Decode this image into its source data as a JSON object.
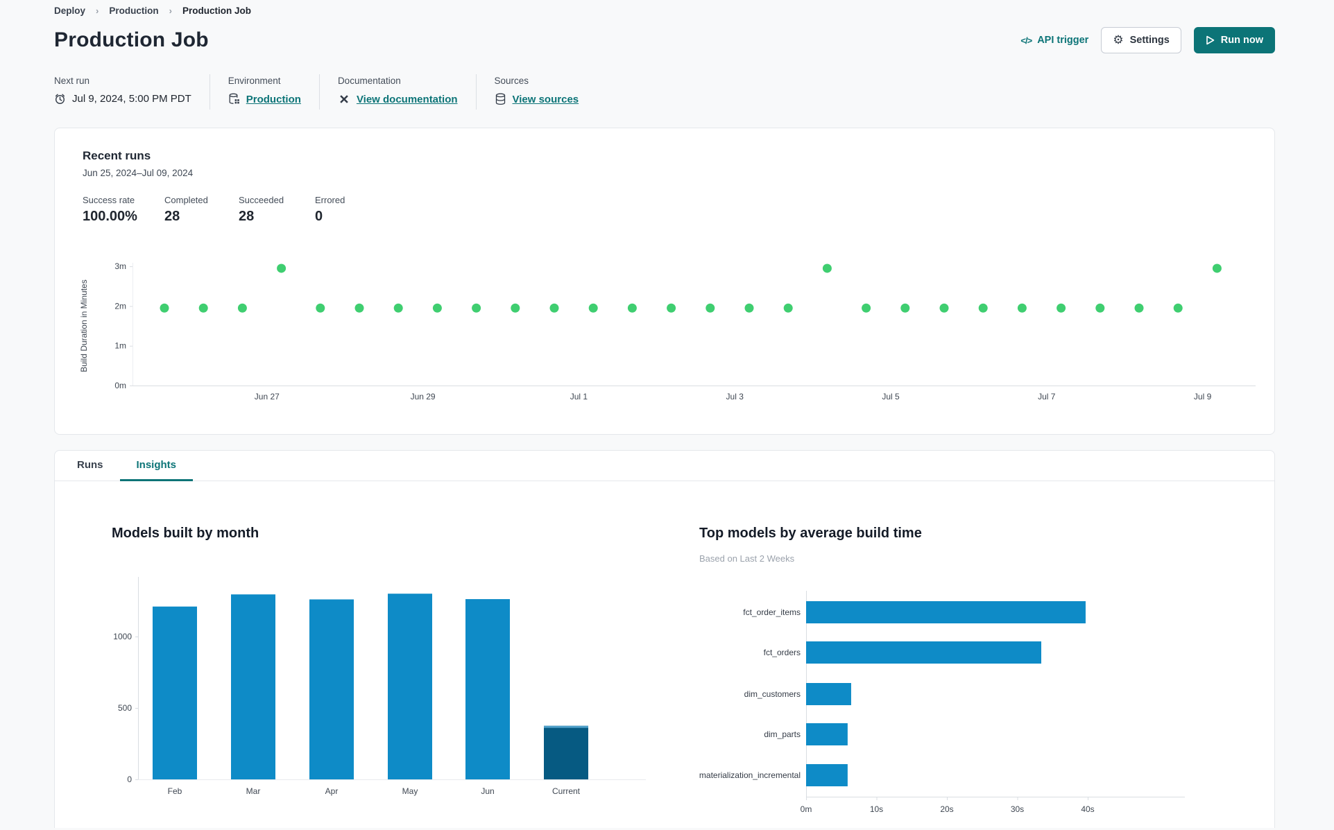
{
  "breadcrumb": {
    "items": [
      "Deploy",
      "Production",
      "Production Job"
    ]
  },
  "header": {
    "title": "Production Job",
    "api_trigger_label": "API trigger",
    "api_trigger_icon": "</>",
    "settings_label": "Settings",
    "settings_icon": "⚙",
    "run_now_label": "Run now"
  },
  "info": {
    "next_run": {
      "label": "Next run",
      "value": "Jul 9, 2024, 5:00 PM PDT",
      "icon": "alarm-clock"
    },
    "environment": {
      "label": "Environment",
      "value": "Production",
      "icon": "environment-database"
    },
    "documentation": {
      "label": "Documentation",
      "value": "View documentation",
      "icon": "dbt-logo"
    },
    "sources": {
      "label": "Sources",
      "value": "View sources",
      "icon": "database"
    }
  },
  "recent_runs": {
    "title": "Recent runs",
    "date_range": "Jun 25, 2024–Jul 09, 2024",
    "stats": [
      {
        "label": "Success rate",
        "value": "100.00%"
      },
      {
        "label": "Completed",
        "value": "28"
      },
      {
        "label": "Succeeded",
        "value": "28"
      },
      {
        "label": "Errored",
        "value": "0"
      }
    ]
  },
  "tabs": [
    {
      "label": "Runs",
      "active": false
    },
    {
      "label": "Insights",
      "active": true
    }
  ],
  "chart_data": [
    {
      "id": "build-duration-scatter",
      "type": "scatter",
      "ylabel": "Build Duration in Minutes",
      "yticks": [
        "0m",
        "1m",
        "2m",
        "3m"
      ],
      "ylim": [
        0,
        3.3
      ],
      "xticks": [
        "Jun 27",
        "Jun 29",
        "Jul 1",
        "Jul 3",
        "Jul 5",
        "Jul 7",
        "Jul 9"
      ],
      "x_range_dates": [
        "Jun 25, 2024",
        "Jul 09, 2024"
      ],
      "points_minutes": [
        1.95,
        1.95,
        1.95,
        2.95,
        1.95,
        1.95,
        1.95,
        1.95,
        1.95,
        1.95,
        1.95,
        1.95,
        1.95,
        1.95,
        1.95,
        1.95,
        1.95,
        2.95,
        1.95,
        1.95,
        1.95,
        1.95,
        1.95,
        1.95,
        1.95,
        1.95,
        1.95,
        2.95
      ],
      "point_color": "#3fce70",
      "grid": false
    },
    {
      "id": "models-built-by-month",
      "type": "bar",
      "title": "Models built by month",
      "categories": [
        "Feb",
        "Mar",
        "Apr",
        "May",
        "Jun",
        "Current"
      ],
      "values": [
        1210,
        1295,
        1260,
        1300,
        1262,
        375
      ],
      "yticks": [
        0,
        500,
        1000
      ],
      "ylim": [
        0,
        1400
      ],
      "bar_color": "#0e8bc7",
      "current_bar_color": "#065a82",
      "current_bar_cap_color": "#4fa0c9",
      "grid": false
    },
    {
      "id": "top-models-by-build-time",
      "type": "bar-horizontal",
      "title": "Top models by average build time",
      "subtitle": "Based on Last 2 Weeks",
      "categories": [
        "fct_order_items",
        "fct_orders",
        "dim_customers",
        "dim_parts",
        "materialization_incremental"
      ],
      "values_seconds": [
        39.7,
        33.4,
        6.4,
        5.9,
        5.9
      ],
      "xticks": [
        "0m",
        "10s",
        "20s",
        "30s",
        "40s"
      ],
      "xlim": [
        0,
        44
      ],
      "bar_color": "#0e8bc7",
      "grid": false
    }
  ],
  "colors": {
    "teal": "#0c7477",
    "page_bg": "#f8f9fa",
    "card_border": "#e4e7eb",
    "axis_line": "#d9dde2",
    "tick_text": "#3e4651",
    "dot_green": "#3fce70",
    "bar_blue": "#0e8bc7",
    "bar_dark": "#065a82"
  }
}
